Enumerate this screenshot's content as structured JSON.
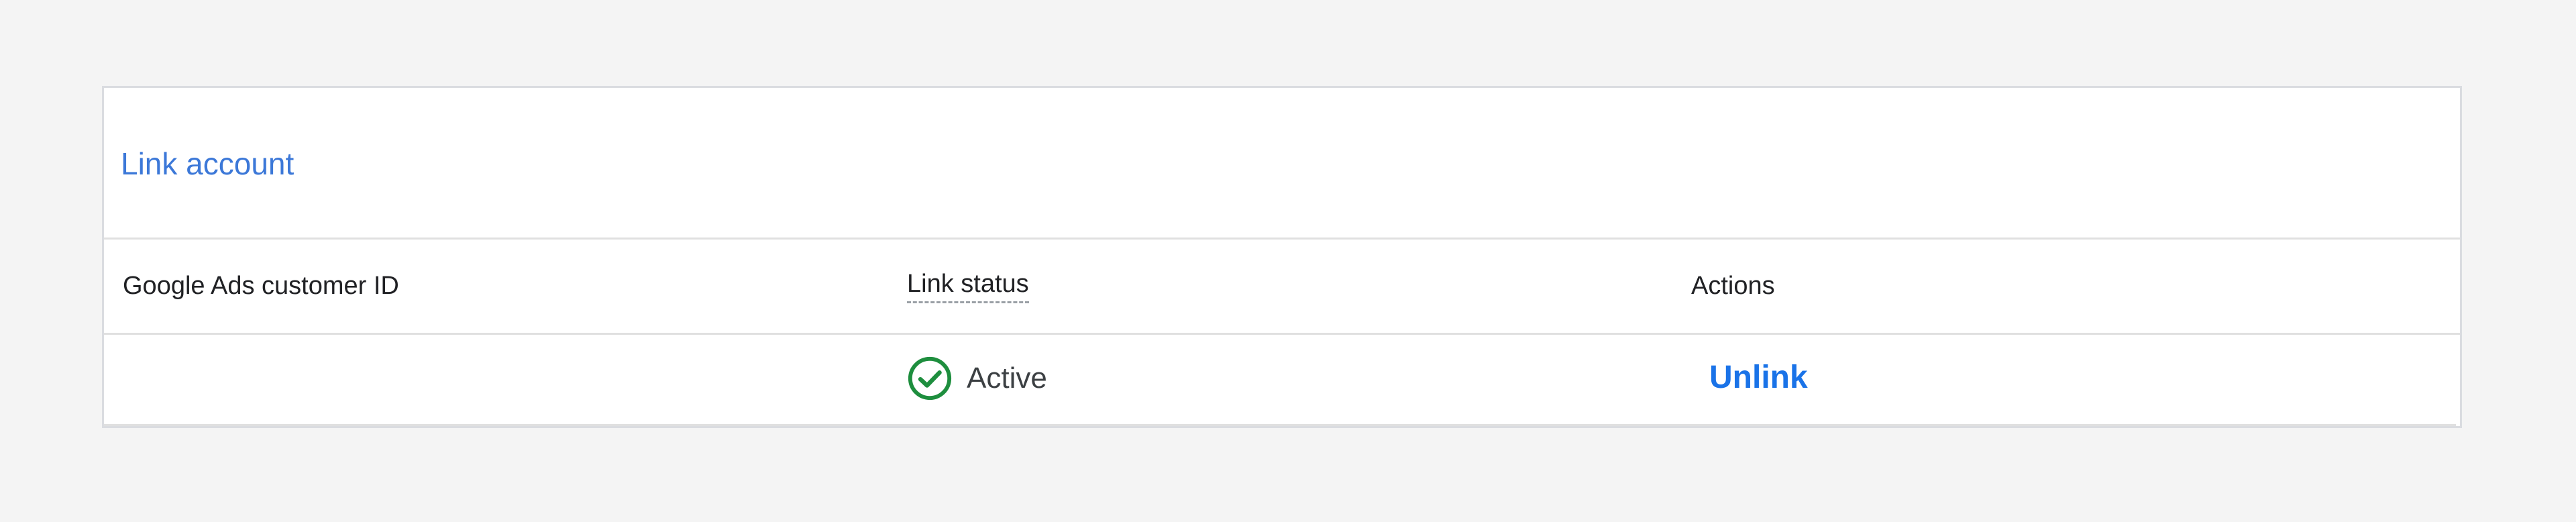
{
  "card": {
    "link_account_label": "Link account"
  },
  "table": {
    "columns": {
      "customer_id": "Google Ads customer ID",
      "link_status": "Link status",
      "actions": "Actions"
    },
    "rows": [
      {
        "customer_id": "",
        "status": "Active",
        "status_icon": "check-circle-icon",
        "action": "Unlink"
      }
    ]
  },
  "colors": {
    "page_background": "#f4f4f4",
    "link": "#3c78d8",
    "action_link": "#1a73e8",
    "status_active": "#1e8e3e"
  }
}
